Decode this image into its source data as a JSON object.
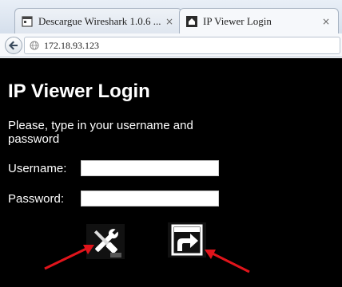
{
  "browser": {
    "tabs": [
      {
        "title": "Descargue Wireshark 1.0.6 ...",
        "close": "×",
        "active": false,
        "favicon": "page-icon"
      },
      {
        "title": "IP Viewer Login",
        "close": "×",
        "active": true,
        "favicon": "home-icon"
      }
    ],
    "address": "172.18.93.123",
    "back_icon": "back-arrow-icon",
    "site_icon": "globe-icon"
  },
  "page": {
    "title": "IP Viewer Login",
    "instructions": "Please, type in your username and password",
    "username_label": "Username:",
    "username_value": "",
    "password_label": "Password:",
    "password_value": "",
    "settings_icon": "tools-icon",
    "login_icon": "login-icon"
  },
  "annotations": {
    "arrow_color": "#e0141b"
  },
  "colors": {
    "page_background": "#000000",
    "page_text": "#ffffff"
  }
}
